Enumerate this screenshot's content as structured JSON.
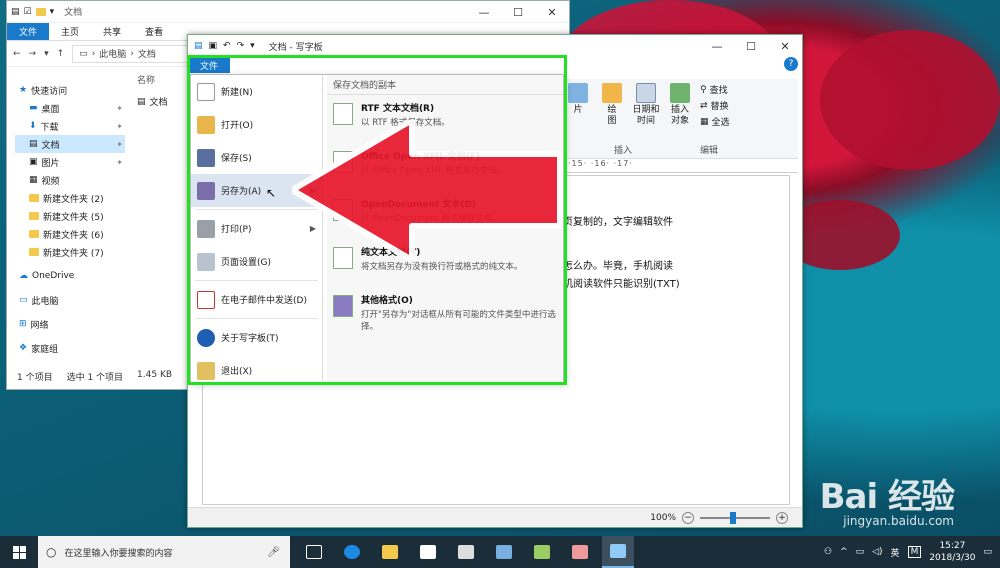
{
  "explorer": {
    "title": "文档",
    "tabs": [
      "文件",
      "主页",
      "共享",
      "查看"
    ],
    "breadcrumb": [
      "此电脑",
      "文档"
    ],
    "nav": [
      {
        "label": "快速访问",
        "icon": "star-icon",
        "pin": false
      },
      {
        "label": "桌面",
        "icon": "desktop-icon",
        "pin": true
      },
      {
        "label": "下载",
        "icon": "download-icon",
        "pin": true
      },
      {
        "label": "文档",
        "icon": "document-icon",
        "pin": true,
        "selected": true
      },
      {
        "label": "图片",
        "icon": "picture-icon",
        "pin": true
      },
      {
        "label": "视频",
        "icon": "video-icon",
        "pin": false
      },
      {
        "label": "新建文件夹 (2)",
        "icon": "folder-icon",
        "pin": false
      },
      {
        "label": "新建文件夹 (5)",
        "icon": "folder-icon",
        "pin": false
      },
      {
        "label": "新建文件夹 (6)",
        "icon": "folder-icon",
        "pin": false
      },
      {
        "label": "新建文件夹 (7)",
        "icon": "folder-icon",
        "pin": false
      },
      {
        "label": "OneDrive",
        "icon": "cloud-icon",
        "pin": false
      },
      {
        "label": "此电脑",
        "icon": "computer-icon",
        "pin": false
      },
      {
        "label": "网络",
        "icon": "network-icon",
        "pin": false
      },
      {
        "label": "家庭组",
        "icon": "homegroup-icon",
        "pin": false
      }
    ],
    "column_name": "名称",
    "file": "文档",
    "status": [
      "1 个项目",
      "选中 1 个项目",
      "1.45 KB"
    ]
  },
  "wordpad": {
    "title": "文档 - 写字板",
    "file_tab": "文件",
    "ribbon": {
      "buttons": [
        "片",
        "绘\n图",
        "日期和\n时间",
        "插入\n对象"
      ],
      "small": [
        "查找",
        "替换",
        "全选"
      ],
      "group_insert": "插入",
      "group_edit": "编辑"
    },
    "ruler": "·15·  ·16·  ·17·",
    "doc_lines": [
      "网页复制的，文字编辑软件",
      "",
      "，怎么办。毕竟，手机阅读",
      "手机阅读软件只能识别(TXT)"
    ],
    "zoom": "100%"
  },
  "file_menu": {
    "items": [
      {
        "label": "新建(N)",
        "icon": "new-doc-icon"
      },
      {
        "label": "打开(O)",
        "icon": "open-folder-icon"
      },
      {
        "label": "保存(S)",
        "icon": "save-icon"
      },
      {
        "label": "另存为(A)",
        "icon": "save-as-icon",
        "active": true,
        "submenu": true
      },
      {
        "label": "打印(P)",
        "icon": "printer-icon",
        "submenu": true
      },
      {
        "label": "页面设置(G)",
        "icon": "page-setup-icon"
      },
      {
        "label": "在电子邮件中发送(D)",
        "icon": "email-icon"
      },
      {
        "label": "关于写字板(T)",
        "icon": "info-icon"
      },
      {
        "label": "退出(X)",
        "icon": "exit-icon"
      }
    ],
    "right_header": "保存文档的副本",
    "options": [
      {
        "title": "RTF 文本文档(R)",
        "desc": "以 RTF 格式保存文档。"
      },
      {
        "title": "Office Open XML 文档(F)",
        "desc": "以 Office Open XML 格式保存文档。"
      },
      {
        "title": "OpenDocument 文本(D)",
        "desc": "以 OpenDocument 格式保存文档。"
      },
      {
        "title": "纯文本文档(T)",
        "desc": "将文档另存为没有换行符或格式的纯文本。"
      },
      {
        "title": "其他格式(O)",
        "desc": "打开\"另存为\"对话框从所有可能的文件类型中进行选择。"
      }
    ]
  },
  "taskbar": {
    "search_placeholder": "在这里输入你要搜索的内容",
    "ime": "英",
    "time": "15:27",
    "date": "2018/3/30"
  },
  "watermark": {
    "brand": "Bai 经验",
    "url": "jingyan.baidu.com"
  },
  "colors": {
    "accent": "#1979ca",
    "highlight": "#22e022",
    "arrow": "#e8162b"
  }
}
